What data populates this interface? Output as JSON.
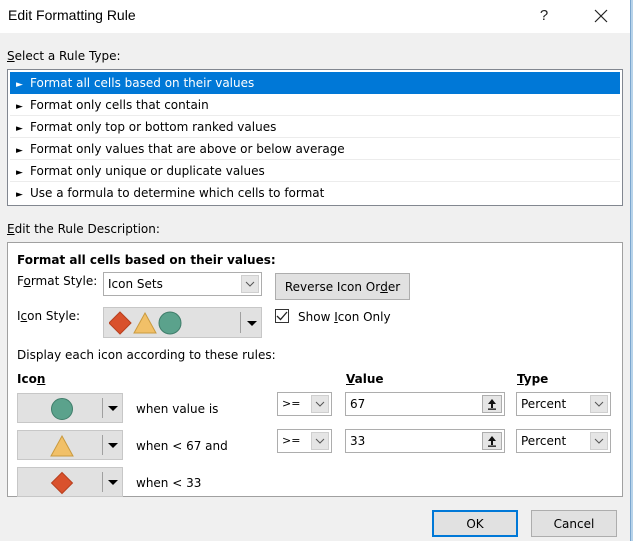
{
  "dialog": {
    "title": "Edit Formatting Rule",
    "help_label": "?",
    "close_icon": "close-icon"
  },
  "rule_type": {
    "label_prefix": "S",
    "label_rest": "elect a Rule Type:",
    "items": [
      {
        "label": "Format all cells based on their values",
        "selected": true
      },
      {
        "label": "Format only cells that contain",
        "selected": false
      },
      {
        "label": "Format only top or bottom ranked values",
        "selected": false
      },
      {
        "label": "Format only values that are above or below average",
        "selected": false
      },
      {
        "label": "Format only unique or duplicate values",
        "selected": false
      },
      {
        "label": "Use a formula to determine which cells to format",
        "selected": false
      }
    ],
    "item_arrow": "►"
  },
  "description": {
    "label_prefix": "E",
    "label_rest": "dit the Rule Description:",
    "heading": "Format all cells based on their values:",
    "format_style_label_a": "F",
    "format_style_label_u": "o",
    "format_style_label_b": "rmat Style:",
    "format_style_value": "Icon Sets",
    "icon_style_label_a": "I",
    "icon_style_label_u": "c",
    "icon_style_label_b": "on Style:",
    "icon_style_value": [
      "red-diamond",
      "yellow-triangle",
      "green-circle"
    ],
    "reverse_button_a": "Reverse Icon Or",
    "reverse_button_u": "d",
    "reverse_button_b": "er",
    "show_icon_only_a": "Show ",
    "show_icon_only_u": "I",
    "show_icon_only_b": "con Only",
    "show_icon_only_checked": true,
    "display_rules_label": "Display each icon according to these rules:",
    "col_icon_a": "Ico",
    "col_icon_u": "n",
    "col_value_u": "V",
    "col_value_b": "alue",
    "col_type_u": "T",
    "col_type_b": "ype",
    "rules": [
      {
        "icon": "green-circle",
        "condition": "when value is",
        "operator": ">=",
        "value": "67",
        "type": "Percent"
      },
      {
        "icon": "yellow-triangle",
        "condition": "when < 67 and",
        "operator": ">=",
        "value": "33",
        "type": "Percent"
      },
      {
        "icon": "red-diamond",
        "condition": "when < 33"
      }
    ]
  },
  "colors": {
    "selection": "#0078d7",
    "red": "#d9512c",
    "yellow": "#f1c068",
    "green": "#5ba28c"
  },
  "footer": {
    "ok_label": "OK",
    "cancel_label": "Cancel"
  }
}
